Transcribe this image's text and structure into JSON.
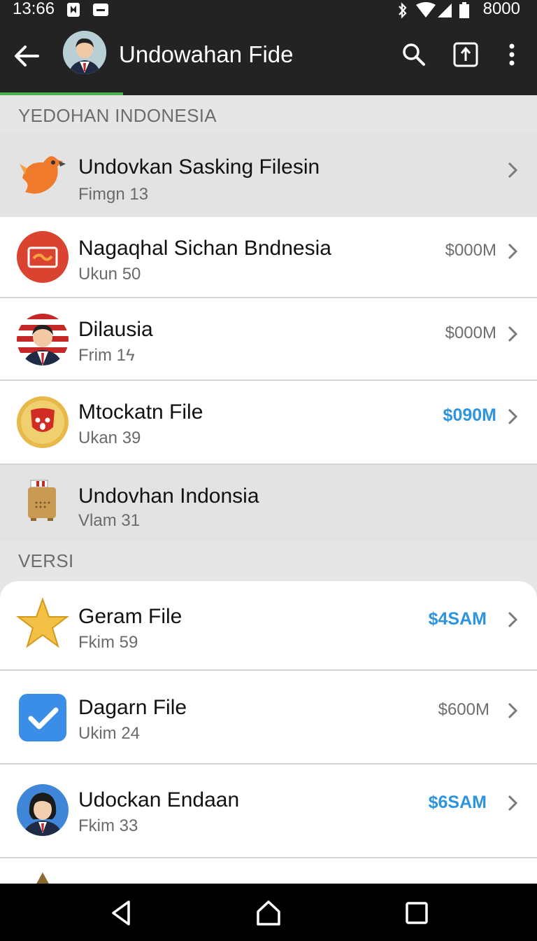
{
  "status_bar": {
    "time": "13:66",
    "battery": "8000",
    "icons": [
      "bookmark-icon",
      "message-icon",
      "bluetooth-icon",
      "wifi-icon",
      "signal-icon",
      "battery-icon"
    ]
  },
  "app_bar": {
    "title": "Undowahan Fide",
    "icons": [
      "back-arrow-icon",
      "avatar",
      "search-icon",
      "upload-icon",
      "overflow-menu-icon"
    ],
    "accent_color": "#4caf50"
  },
  "sections": [
    {
      "header": "YEDOHAN INDONESIA",
      "items": [
        {
          "name": "Undovkan Sasking Filesin",
          "sub": "Fimgn 13",
          "amount": "",
          "amount_highlight": false,
          "icon": "bird-icon"
        },
        {
          "name": "Nagaqhal Sichan Bndnesia",
          "sub": "Ukun 50",
          "amount": "$000M",
          "amount_highlight": false,
          "icon": "mail-icon"
        },
        {
          "name": "Dilausia",
          "sub": "Frim 1ϟ",
          "amount": "$000M",
          "amount_highlight": false,
          "icon": "person-flag-icon"
        },
        {
          "name": "Mtockatn File",
          "sub": "Ukan 39",
          "amount": "$090M",
          "amount_highlight": true,
          "icon": "mascot-icon"
        },
        {
          "name": "Undovhan Indonsia",
          "sub": "Vlam 31",
          "amount": "",
          "amount_highlight": false,
          "icon": "radio-icon"
        }
      ]
    },
    {
      "header": "VERSI",
      "items": [
        {
          "name": "Geram File",
          "sub": "Fkim 59",
          "amount": "$4SAM",
          "amount_highlight": true,
          "icon": "star-icon"
        },
        {
          "name": "Dagarn File",
          "sub": "Ukim 24",
          "amount": "$600M",
          "amount_highlight": false,
          "icon": "checkmark-icon"
        },
        {
          "name": "Udockan Endaan",
          "sub": "Fkim 33",
          "amount": "$6SAM",
          "amount_highlight": true,
          "icon": "woman-avatar-icon"
        }
      ]
    }
  ],
  "nav_bar": {
    "icons": [
      "back-triangle-icon",
      "home-icon",
      "recents-icon"
    ]
  },
  "colors": {
    "highlight_amount": "#2f94e0",
    "app_bar_bg": "#232323"
  }
}
